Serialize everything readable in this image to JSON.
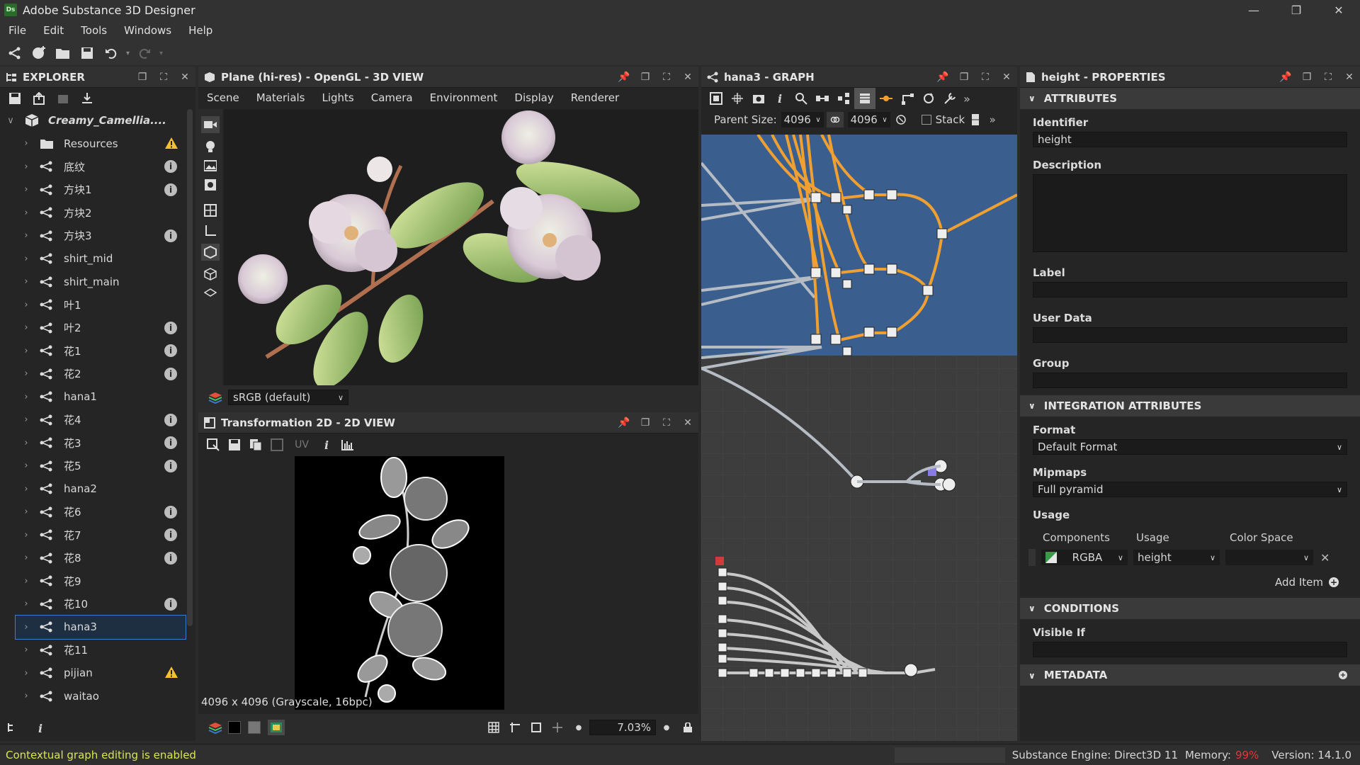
{
  "window": {
    "title": "Adobe Substance 3D Designer",
    "logo": "Ds"
  },
  "menu": [
    "File",
    "Edit",
    "Tools",
    "Windows",
    "Help"
  ],
  "explorer": {
    "title": "EXPLORER",
    "package": "Creamy_Camellia....",
    "items": [
      {
        "label": "Resources",
        "badge": "warn"
      },
      {
        "label": "底纹",
        "badge": "info"
      },
      {
        "label": "方块1",
        "badge": "info"
      },
      {
        "label": "方块2",
        "badge": ""
      },
      {
        "label": "方块3",
        "badge": "info"
      },
      {
        "label": "shirt_mid",
        "badge": ""
      },
      {
        "label": "shirt_main",
        "badge": ""
      },
      {
        "label": "叶1",
        "badge": ""
      },
      {
        "label": "叶2",
        "badge": "info"
      },
      {
        "label": "花1",
        "badge": "info"
      },
      {
        "label": "花2",
        "badge": "info"
      },
      {
        "label": "hana1",
        "badge": ""
      },
      {
        "label": "花4",
        "badge": "info"
      },
      {
        "label": "花3",
        "badge": "info"
      },
      {
        "label": "花5",
        "badge": "info"
      },
      {
        "label": "hana2",
        "badge": ""
      },
      {
        "label": "花6",
        "badge": "info"
      },
      {
        "label": "花7",
        "badge": "info"
      },
      {
        "label": "花8",
        "badge": "info"
      },
      {
        "label": "花9",
        "badge": ""
      },
      {
        "label": "花10",
        "badge": "info"
      },
      {
        "label": "hana3",
        "badge": "",
        "selected": true
      },
      {
        "label": "花11",
        "badge": ""
      },
      {
        "label": "pijian",
        "badge": "warn"
      },
      {
        "label": "waitao",
        "badge": ""
      }
    ]
  },
  "view3d": {
    "title": "Plane (hi-res) - OpenGL - 3D VIEW",
    "menu": [
      "Scene",
      "Materials",
      "Lights",
      "Camera",
      "Environment",
      "Display",
      "Renderer"
    ],
    "colorspace": "sRGB (default)"
  },
  "view2d": {
    "title": "Transformation 2D - 2D VIEW",
    "uv": "UV",
    "info": "4096 x 4096 (Grayscale, 16bpc)",
    "zoom": "7.03%"
  },
  "graph": {
    "title": "hana3 - GRAPH",
    "parent_size_label": "Parent Size:",
    "parent_size": "4096",
    "size2": "4096",
    "stack": "Stack"
  },
  "properties": {
    "title": "height - PROPERTIES",
    "sections": {
      "attributes": "ATTRIBUTES",
      "integration": "INTEGRATION ATTRIBUTES",
      "conditions": "CONDITIONS",
      "metadata": "METADATA"
    },
    "labels": {
      "identifier": "Identifier",
      "description": "Description",
      "label": "Label",
      "user_data": "User Data",
      "group": "Group",
      "format": "Format",
      "mipmaps": "Mipmaps",
      "usage": "Usage",
      "components": "Components",
      "usage_col": "Usage",
      "color_space": "Color Space",
      "add_item": "Add Item",
      "visible_if": "Visible If"
    },
    "values": {
      "identifier": "height",
      "format": "Default Format",
      "mipmaps": "Full pyramid",
      "components": "RGBA",
      "usage": "height"
    }
  },
  "status": {
    "left": "Contextual graph editing is enabled",
    "engine": "Substance Engine: Direct3D 11",
    "memory_label": "Memory:",
    "memory": "99%",
    "version": "Version: 14.1.0"
  },
  "colors": {
    "accent": "#3c7bd0",
    "status_green": "#d8e84a",
    "memory_red": "#e23838",
    "wire_orange": "#f0a030",
    "graph_blue": "#3a5f8f"
  }
}
